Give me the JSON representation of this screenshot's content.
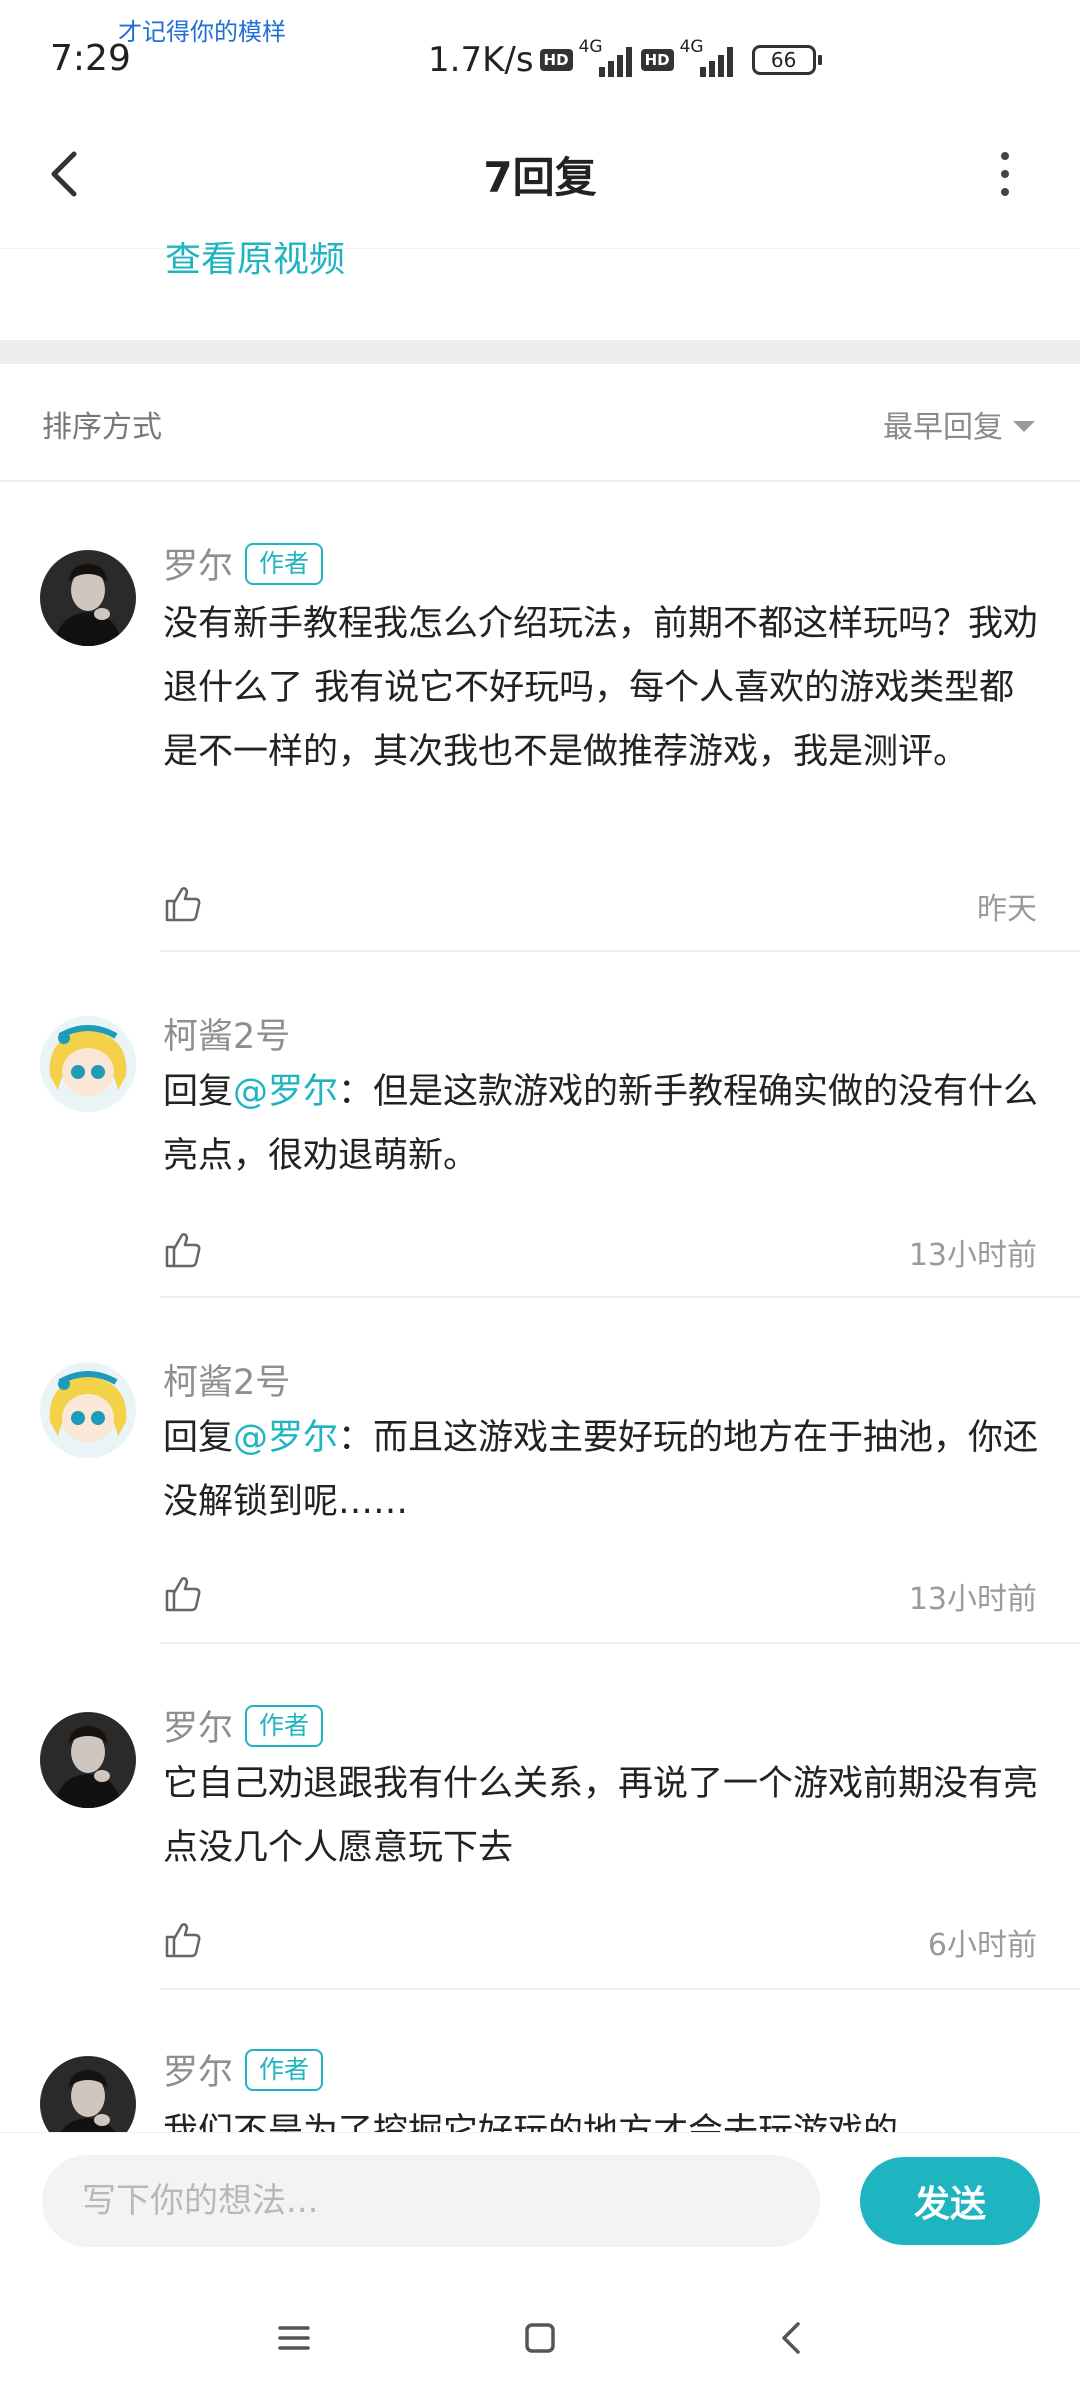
{
  "status_bar": {
    "time": "7:29",
    "note": "才记得你的模样",
    "speed": "1.7K/s",
    "hd_label": "HD",
    "network": "4G",
    "battery": "66"
  },
  "header": {
    "title": "7回复"
  },
  "top": {
    "view_original": "查看原视频"
  },
  "sort": {
    "label": "排序方式",
    "value": "最早回复"
  },
  "replies": [
    {
      "user": "罗尔",
      "badge": "作者",
      "text": "没有新手教程我怎么介绍玩法，前期不都这样玩吗？我劝退什么了 我有说它不好玩吗，每个人喜欢的游戏类型都是不一样的，其次我也不是做推荐游戏，我是测评。",
      "time": "昨天"
    },
    {
      "user": "柯酱2号",
      "prefix": "回复",
      "mention": "@罗尔",
      "text": "：但是这款游戏的新手教程确实做的没有什么亮点，很劝退萌新。",
      "time": "13小时前"
    },
    {
      "user": "柯酱2号",
      "prefix": "回复",
      "mention": "@罗尔",
      "text": "：而且这游戏主要好玩的地方在于抽池，你还没解锁到呢……",
      "time": "13小时前"
    },
    {
      "user": "罗尔",
      "badge": "作者",
      "text": "它自己劝退跟我有什么关系，再说了一个游戏前期没有亮点没几个人愿意玩下去",
      "time": "6小时前"
    },
    {
      "user": "罗尔",
      "badge": "作者",
      "text": "我们不是为了挖掘它好玩的地方才会去玩游戏的"
    }
  ],
  "composer": {
    "placeholder": "写下你的想法...",
    "send_label": "发送"
  },
  "colors": {
    "accent": "#1fb5c0",
    "separator": "#ededed"
  }
}
